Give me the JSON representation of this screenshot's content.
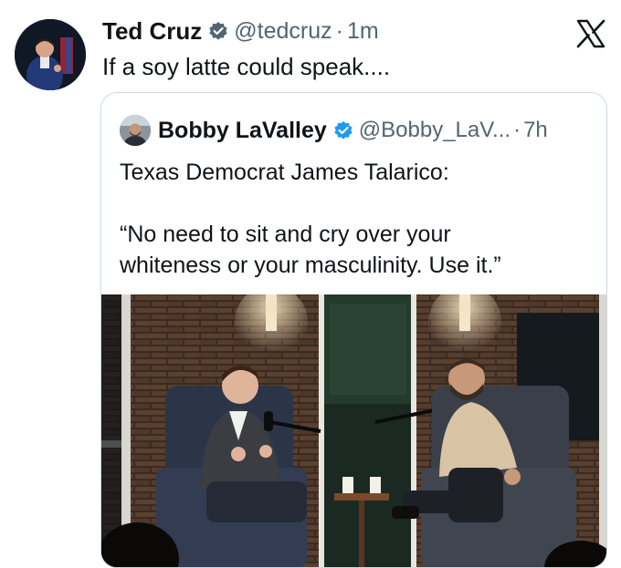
{
  "tweet": {
    "author_name": "Ted Cruz",
    "author_handle": "@tedcruz",
    "separator": "·",
    "time": "1m",
    "text": "If a soy latte could speak...."
  },
  "quoted": {
    "author_name": "Bobby LaValley",
    "author_handle": "@Bobby_LaV...",
    "separator": "·",
    "time": "7h",
    "text_line1": "Texas Democrat James Talarico:",
    "text_line2": "“No need to sit and cry over your",
    "text_line3": "whiteness or your masculinity. Use it.”"
  },
  "icons": {
    "verified": "verified-badge-icon",
    "close": "x-logo-icon"
  },
  "colors": {
    "verified_blue": "#1d9bf0",
    "secondary_text": "#536471",
    "border": "#cfd9de"
  }
}
